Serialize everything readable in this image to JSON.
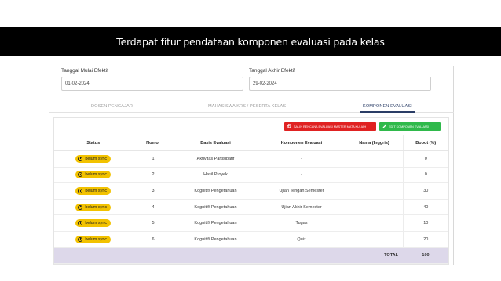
{
  "slide": {
    "title": "Terdapat fitur pendataan komponen evaluasi pada kelas"
  },
  "dates": {
    "start_label": "Tanggal Mulai Efektif",
    "start_value": "01-02-2024",
    "end_label": "Tanggal Akhir Efektif",
    "end_value": "29-02-2024"
  },
  "tabs": [
    {
      "label": "DOSEN PENGAJAR",
      "active": false
    },
    {
      "label": "MAHASISWA KRS / PESERTA KELAS",
      "active": false
    },
    {
      "label": "KOMPONEN EVALUASI",
      "active": true
    }
  ],
  "toolbar": {
    "copy_label": "SALIN RENCANA EVALUASI MASTER MATA KULIAH",
    "edit_label": "EDIT KOMPONEN EVALUASI"
  },
  "table": {
    "headers": [
      "Status",
      "Nomor",
      "Basis Evaluasi",
      "Komponen Evaluasi",
      "Nama (Inggris)",
      "Bobot (%)"
    ],
    "rows": [
      {
        "status": "belum sync",
        "nomor": "1",
        "basis": "Aktivitas Partisipatif",
        "komponen": "-",
        "nama_inggris": "",
        "bobot": "0"
      },
      {
        "status": "belum sync",
        "nomor": "2",
        "basis": "Hasil Proyek",
        "komponen": "-",
        "nama_inggris": "",
        "bobot": "0"
      },
      {
        "status": "belum sync",
        "nomor": "3",
        "basis": "Kognitif/ Pengetahuan",
        "komponen": "Ujian Tengah Semester",
        "nama_inggris": "",
        "bobot": "30"
      },
      {
        "status": "belum sync",
        "nomor": "4",
        "basis": "Kognitif/ Pengetahuan",
        "komponen": "Ujian Akhir Semester",
        "nama_inggris": "",
        "bobot": "40"
      },
      {
        "status": "belum sync",
        "nomor": "5",
        "basis": "Kognitif/ Pengetahuan",
        "komponen": "Tugas",
        "nama_inggris": "",
        "bobot": "10"
      },
      {
        "status": "belum sync",
        "nomor": "6",
        "basis": "Kognitif/ Pengetahuan",
        "komponen": "Quiz",
        "nama_inggris": "",
        "bobot": "20"
      }
    ],
    "total_label": "TOTAL",
    "total_value": "100"
  },
  "colors": {
    "title_bar": "#000000",
    "badge": "#f2c200",
    "button_red": "#e02222",
    "button_green": "#2fb94b",
    "total_row": "#ddd8ea",
    "active_tab": "#2a3d66"
  },
  "icons": {
    "copy_button": "copy-icon",
    "edit_button": "pencil-icon",
    "status_badge": "clock-icon"
  }
}
